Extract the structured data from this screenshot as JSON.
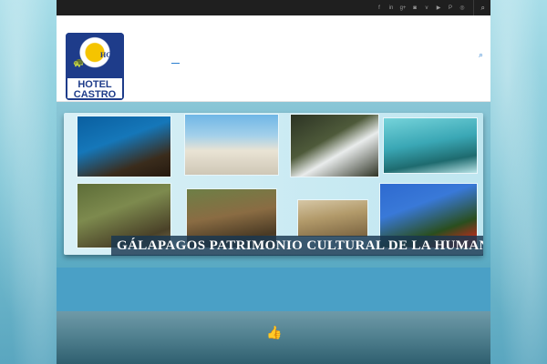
{
  "topbar": {
    "social_icons": [
      {
        "name": "facebook-icon",
        "glyph": "f"
      },
      {
        "name": "linkedin-icon",
        "glyph": "in"
      },
      {
        "name": "google-plus-icon",
        "glyph": "g+"
      },
      {
        "name": "instagram-icon",
        "glyph": "◙"
      },
      {
        "name": "vimeo-icon",
        "glyph": "v"
      },
      {
        "name": "youtube-icon",
        "glyph": "▶"
      },
      {
        "name": "pinterest-icon",
        "glyph": "P"
      },
      {
        "name": "dribbble-icon",
        "glyph": "◎"
      }
    ],
    "search_icon": "⌕"
  },
  "header": {
    "logo_text_line1": "HOTEL",
    "logo_text_line2": "CASTRO",
    "logo_initials": "HC",
    "search_icon": "⌕"
  },
  "banner": {
    "caption": "GÁLAPAGOS PATRIMONIO CULTURAL DE LA HUMANIDAD"
  },
  "footer": {
    "like_icon": "👍"
  },
  "colors": {
    "topbar": "#1f1f1f",
    "accent": "#2b7fd0",
    "band": "#4aa0c6",
    "logo_blue": "#1e3c8a"
  }
}
